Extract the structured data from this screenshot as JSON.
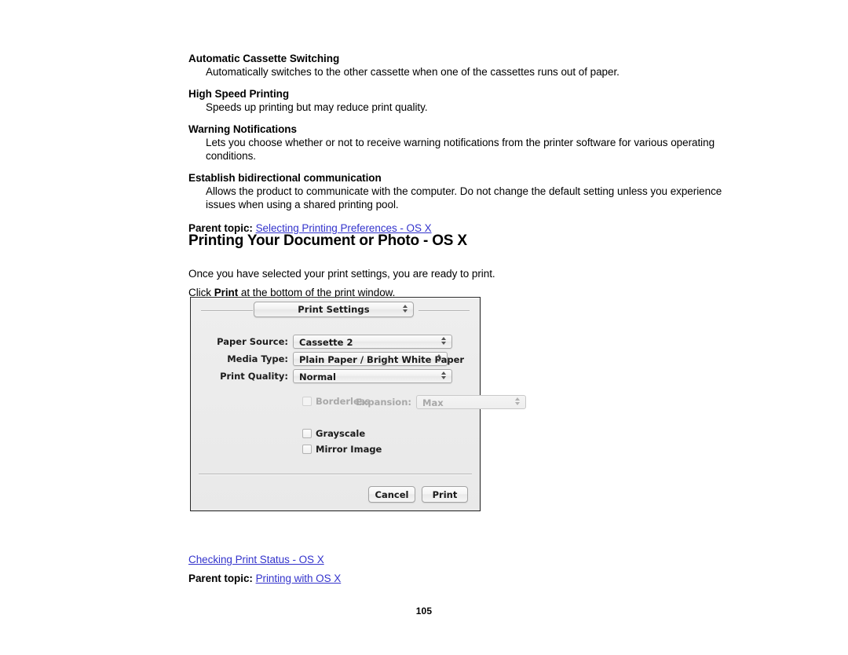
{
  "document": {
    "definitions": [
      {
        "term": "Automatic Cassette Switching",
        "definition": "Automatically switches to the other cassette when one of the cassettes runs out of paper."
      },
      {
        "term": "High Speed Printing",
        "definition": "Speeds up printing but may reduce print quality."
      },
      {
        "term": "Warning Notifications",
        "definition": "Lets you choose whether or not to receive warning notifications from the printer software for various operating conditions."
      },
      {
        "term": "Establish bidirectional communication",
        "definition": "Allows the product to communicate with the computer. Do not change the default setting unless you experience issues when using a shared printing pool."
      }
    ],
    "parent_topic_top": {
      "label": "Parent topic:",
      "link": "Selecting Printing Preferences - OS X"
    },
    "section_title": "Printing Your Document or Photo - OS X",
    "paragraph_1": "Once you have selected your print settings, you are ready to print.",
    "paragraph_2_prefix": "Click ",
    "paragraph_2_bold": "Print",
    "paragraph_2_suffix": " at the bottom of the print window.",
    "bottom_link": "Checking Print Status - OS X",
    "parent_topic_bottom": {
      "label": "Parent topic:",
      "link": "Printing with OS X"
    },
    "page_number": "105",
    "link_color": "#3333cc"
  },
  "print_dialog": {
    "pane_popup": {
      "label": "Print Settings",
      "icon": "stepper-updown-icon"
    },
    "fields": [
      {
        "label": "Paper Source:",
        "value": "Cassette 2",
        "disabled": false
      },
      {
        "label": "Media Type:",
        "value": "Plain Paper / Bright White Paper",
        "disabled": false
      },
      {
        "label": "Print Quality:",
        "value": "Normal",
        "disabled": false
      }
    ],
    "borderless": {
      "label": "Borderless",
      "checked": false,
      "disabled": true
    },
    "expansion": {
      "label": "Expansion:",
      "value": "Max",
      "disabled": true
    },
    "checkboxes": [
      {
        "label": "Grayscale",
        "checked": false
      },
      {
        "label": "Mirror Image",
        "checked": false
      }
    ],
    "buttons": {
      "cancel": "Cancel",
      "print": "Print"
    }
  }
}
